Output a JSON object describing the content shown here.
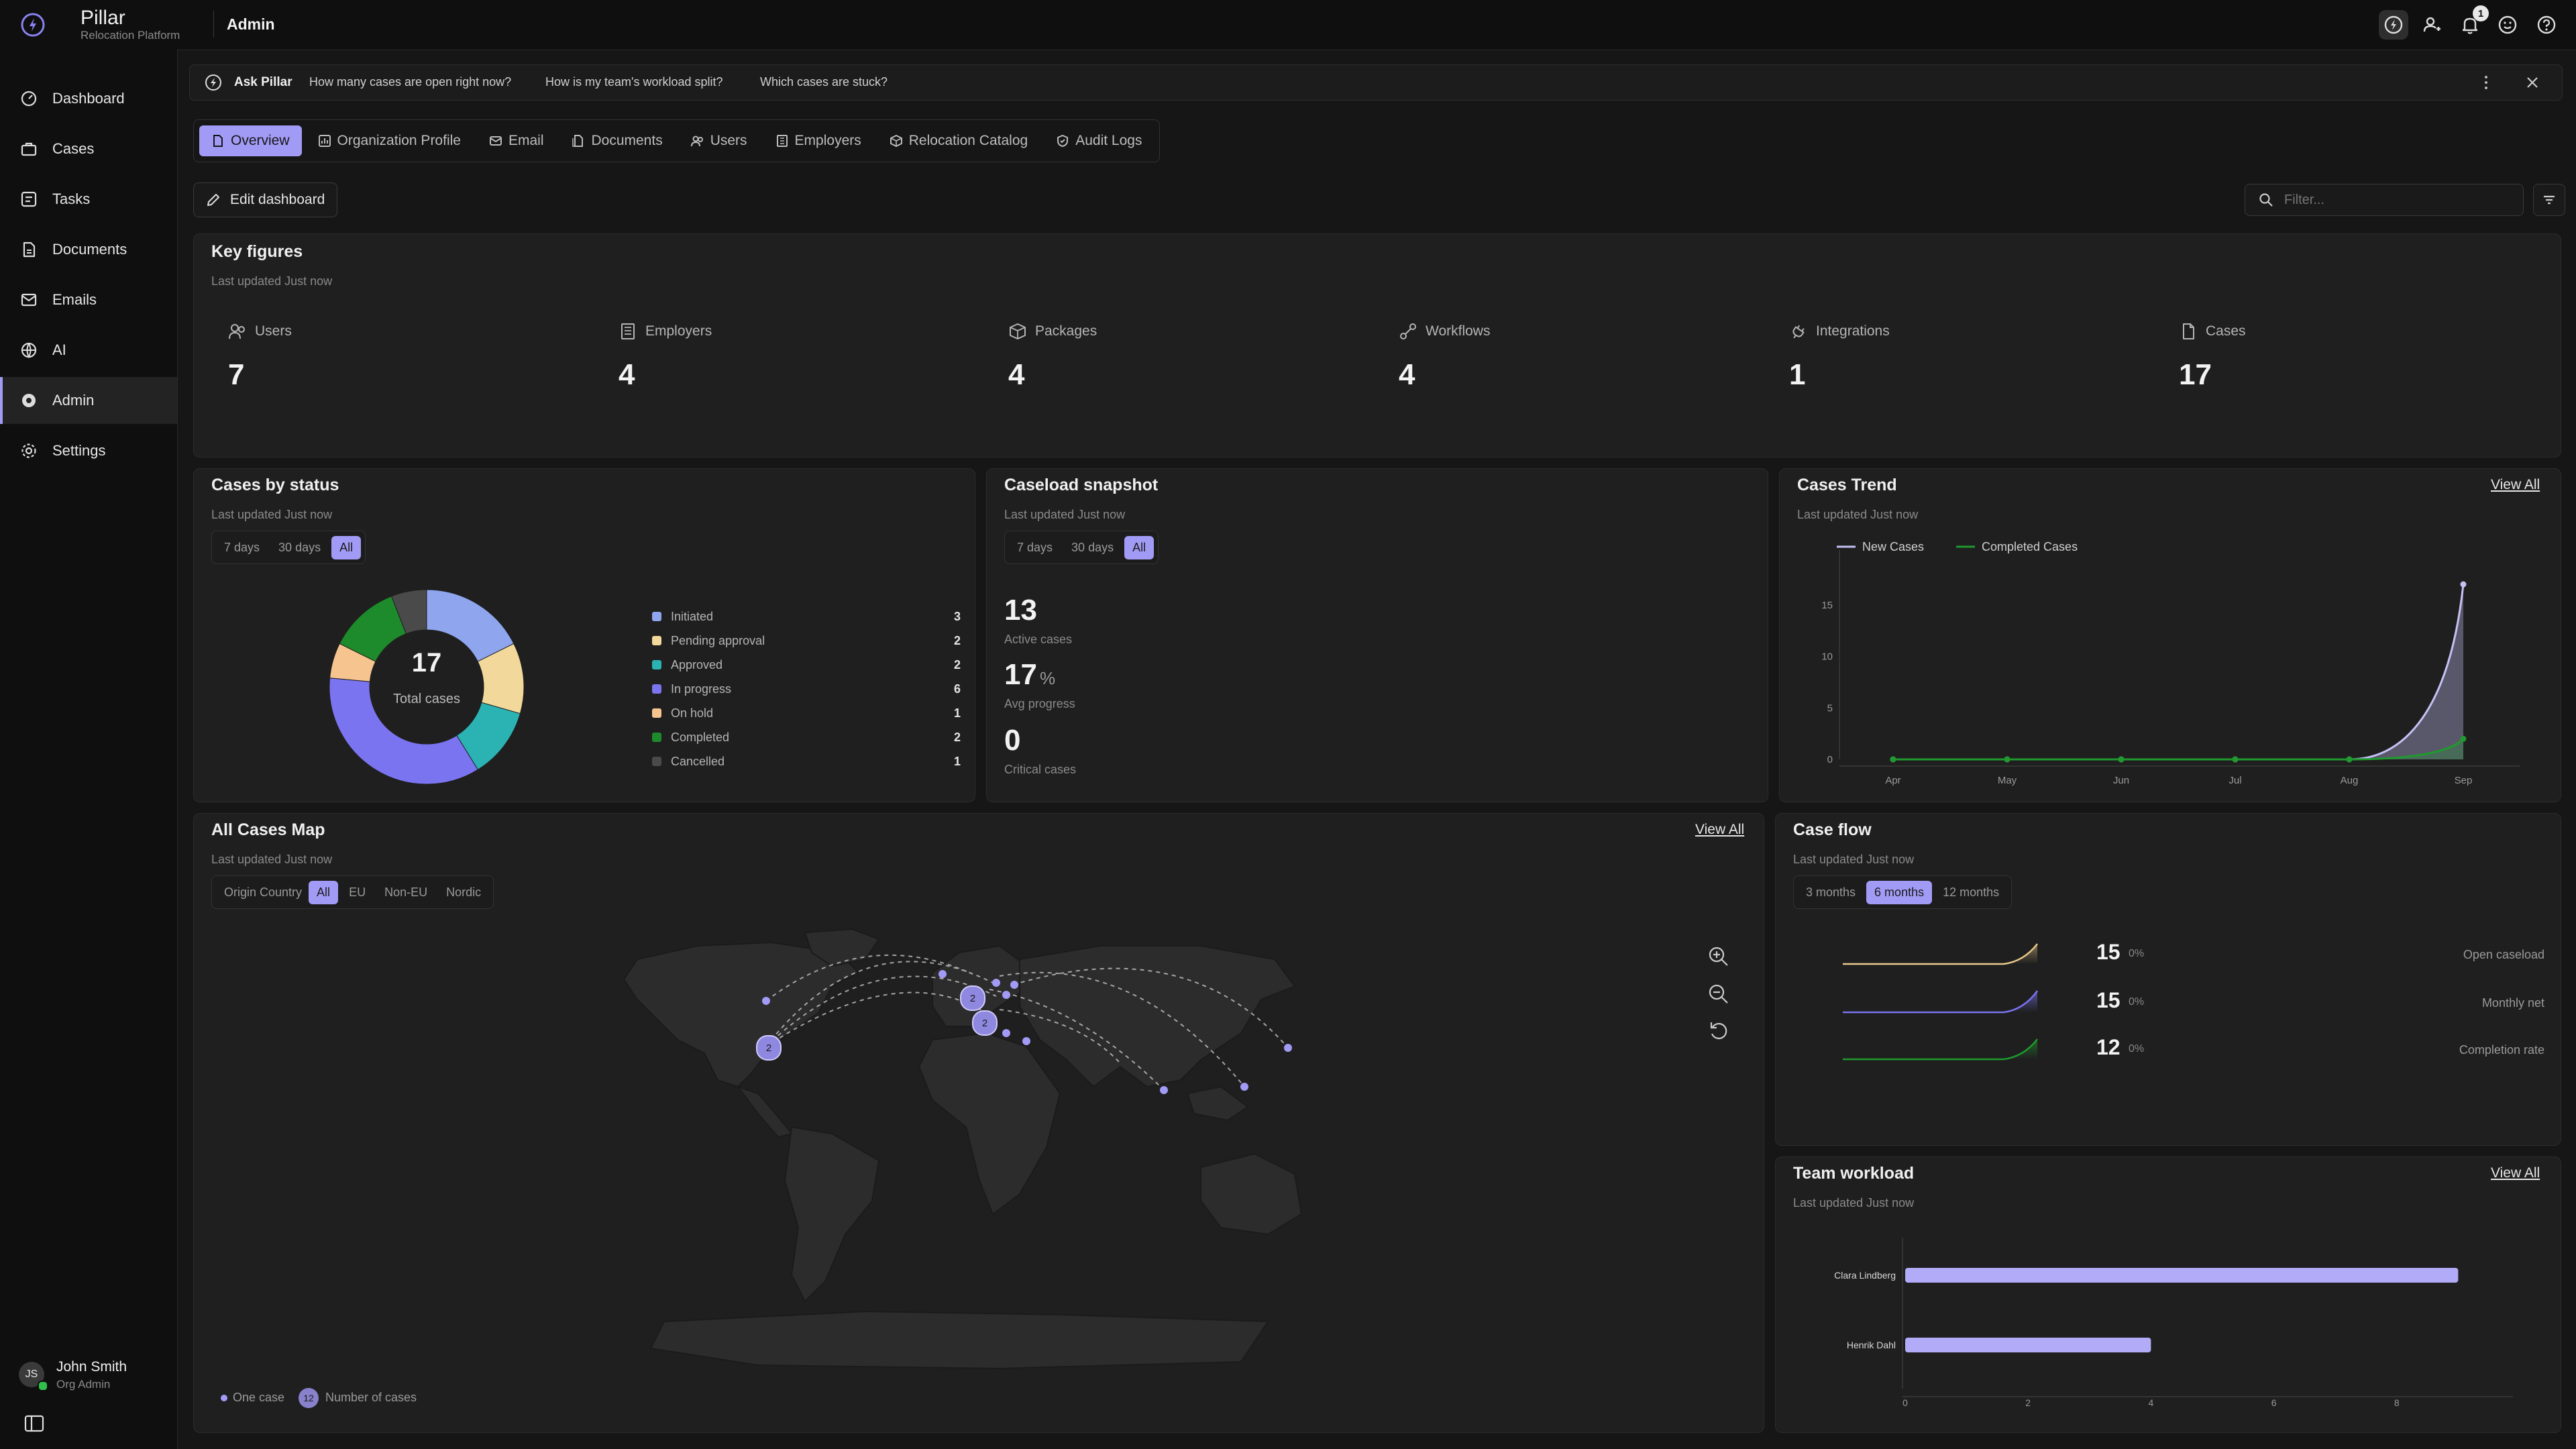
{
  "app": {
    "name": "Pillar",
    "subtitle": "Relocation Platform",
    "section": "Admin"
  },
  "topbar": {
    "notification_count": "1",
    "icons": [
      "pillar-ai-icon",
      "user-switch-icon",
      "bell-icon",
      "smile-icon",
      "help-icon"
    ]
  },
  "sidebar": {
    "items": [
      {
        "label": "Dashboard",
        "icon": "dashboard-icon"
      },
      {
        "label": "Cases",
        "icon": "briefcase-icon"
      },
      {
        "label": "Tasks",
        "icon": "tasks-icon"
      },
      {
        "label": "Documents",
        "icon": "document-icon"
      },
      {
        "label": "Emails",
        "icon": "mail-icon"
      },
      {
        "label": "AI",
        "icon": "ai-icon"
      },
      {
        "label": "Admin",
        "icon": "admin-icon",
        "active": true
      },
      {
        "label": "Settings",
        "icon": "gear-icon"
      }
    ],
    "user": {
      "initials": "JS",
      "name": "John Smith",
      "role": "Org Admin"
    }
  },
  "ask": {
    "label": "Ask Pillar",
    "suggestions": [
      "How many cases are open right now?",
      "How is my team's workload split?",
      "Which cases are stuck?"
    ]
  },
  "tabs": [
    "Overview",
    "Organization Profile",
    "Email",
    "Documents",
    "Users",
    "Employers",
    "Relocation Catalog",
    "Audit Logs"
  ],
  "toolbar": {
    "edit_label": "Edit dashboard",
    "filter_placeholder": "Filter..."
  },
  "key_figures": {
    "title": "Key figures",
    "updated": "Last updated Just now",
    "items": [
      {
        "label": "Users",
        "value": "7",
        "icon": "users-icon"
      },
      {
        "label": "Employers",
        "value": "4",
        "icon": "building-icon"
      },
      {
        "label": "Packages",
        "value": "4",
        "icon": "package-icon"
      },
      {
        "label": "Workflows",
        "value": "4",
        "icon": "workflow-icon"
      },
      {
        "label": "Integrations",
        "value": "1",
        "icon": "plug-icon"
      },
      {
        "label": "Cases",
        "value": "17",
        "icon": "file-icon"
      }
    ]
  },
  "cases_by_status": {
    "title": "Cases by status",
    "updated": "Last updated Just now",
    "ranges": [
      "7 days",
      "30 days",
      "All"
    ],
    "active_range": "All",
    "total": "17",
    "total_label": "Total cases",
    "statuses": [
      {
        "label": "Initiated",
        "count": "3",
        "color": "#8fa6ef"
      },
      {
        "label": "Pending approval",
        "count": "2",
        "color": "#f2d99b"
      },
      {
        "label": "Approved",
        "count": "2",
        "color": "#2bb3b3"
      },
      {
        "label": "In progress",
        "count": "6",
        "color": "#7b74f0"
      },
      {
        "label": "On hold",
        "count": "1",
        "color": "#f6c48f"
      },
      {
        "label": "Completed",
        "count": "2",
        "color": "#1d8a2b"
      },
      {
        "label": "Cancelled",
        "count": "1",
        "color": "#4a4a4a"
      }
    ]
  },
  "caseload": {
    "title": "Caseload snapshot",
    "updated": "Last updated Just now",
    "ranges": [
      "7 days",
      "30 days",
      "All"
    ],
    "active_range": "All",
    "active": "13",
    "active_label": "Active cases",
    "avg": "17",
    "avg_unit": "%",
    "avg_label": "Avg progress",
    "critical": "0",
    "critical_label": "Critical cases"
  },
  "cases_trend": {
    "title": "Cases Trend",
    "view_all": "View All",
    "updated": "Last updated Just now"
  },
  "chart_data": {
    "type": "area",
    "x": [
      "Apr",
      "May",
      "Jun",
      "Jul",
      "Aug",
      "Sep"
    ],
    "series": [
      {
        "name": "New Cases",
        "values": [
          0,
          0,
          0,
          0,
          0,
          17
        ],
        "color": "#c5c1f5"
      },
      {
        "name": "Completed Cases",
        "values": [
          0,
          0,
          0,
          0,
          0,
          2
        ],
        "color": "#1f9a2e"
      }
    ],
    "y_ticks": [
      "0",
      "5",
      "10",
      "15"
    ],
    "ylim": [
      0,
      20
    ],
    "legend": "top-left",
    "grid": false
  },
  "map": {
    "title": "All Cases Map",
    "view_all": "View All",
    "updated": "Last updated Just now",
    "filter_label": "Origin Country",
    "filters": [
      "All",
      "EU",
      "Non-EU",
      "Nordic"
    ],
    "active_filter": "All",
    "cluster_labels": [
      "2",
      "2",
      "2"
    ],
    "legend": {
      "one": "One case",
      "badge": "12",
      "many": "Number of cases"
    },
    "controls": [
      "zoom-in-icon",
      "zoom-out-icon",
      "reset-icon"
    ]
  },
  "case_flow": {
    "title": "Case flow",
    "updated": "Last updated Just now",
    "ranges": [
      "3 months",
      "6 months",
      "12 months"
    ],
    "active_range": "6 months",
    "rows": [
      {
        "value": "15",
        "pct": "0%",
        "label": "Open caseload",
        "color": "#e8c98a"
      },
      {
        "value": "15",
        "pct": "0%",
        "label": "Monthly net",
        "color": "#7b74f0"
      },
      {
        "value": "12",
        "pct": "0%",
        "label": "Completion rate",
        "color": "#1f9a2e"
      }
    ]
  },
  "team_workload": {
    "title": "Team workload",
    "view_all": "View All",
    "updated": "Last updated Just now",
    "members": [
      {
        "name": "Clara Lindberg",
        "cases": 9
      },
      {
        "name": "Henrik Dahl",
        "cases": 4
      }
    ],
    "x_ticks": [
      "0",
      "2",
      "4",
      "6",
      "8"
    ],
    "xlim": [
      0,
      10
    ]
  }
}
